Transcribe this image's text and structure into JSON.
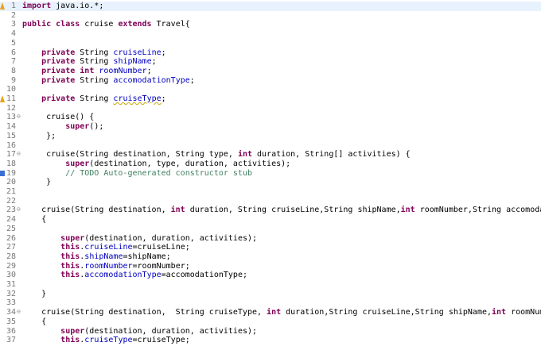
{
  "colors": {
    "keyword": "#7f0055",
    "field": "#0000c0",
    "comment": "#3f7f5f",
    "line_number": "#787878",
    "current_line": "#e8f2fe",
    "warning_marker": "#e8a317",
    "task_marker": "#3b6fd4"
  },
  "lines": [
    {
      "n": "1",
      "marker": "warning-icon",
      "tokens": [
        {
          "t": "import",
          "c": "kw"
        },
        {
          "t": " java.io.*;"
        }
      ]
    },
    {
      "n": "2",
      "tokens": []
    },
    {
      "n": "3",
      "tokens": [
        {
          "t": "public",
          "c": "kw"
        },
        {
          "t": " "
        },
        {
          "t": "class",
          "c": "kw"
        },
        {
          "t": " cruise "
        },
        {
          "t": "extends",
          "c": "kw"
        },
        {
          "t": " Travel{"
        }
      ]
    },
    {
      "n": "4",
      "tokens": []
    },
    {
      "n": "5",
      "tokens": []
    },
    {
      "n": "6",
      "tokens": [
        {
          "t": "    "
        },
        {
          "t": "private",
          "c": "kw"
        },
        {
          "t": " String "
        },
        {
          "t": "cruiseLine",
          "c": "fld"
        },
        {
          "t": ";"
        }
      ]
    },
    {
      "n": "7",
      "tokens": [
        {
          "t": "    "
        },
        {
          "t": "private",
          "c": "kw"
        },
        {
          "t": " String "
        },
        {
          "t": "shipName",
          "c": "fld"
        },
        {
          "t": ";"
        }
      ]
    },
    {
      "n": "8",
      "tokens": [
        {
          "t": "    "
        },
        {
          "t": "private",
          "c": "kw"
        },
        {
          "t": " "
        },
        {
          "t": "int",
          "c": "kw"
        },
        {
          "t": " "
        },
        {
          "t": "roomNumber",
          "c": "fld"
        },
        {
          "t": ";"
        }
      ]
    },
    {
      "n": "9",
      "tokens": [
        {
          "t": "    "
        },
        {
          "t": "private",
          "c": "kw"
        },
        {
          "t": " String "
        },
        {
          "t": "accomodationType",
          "c": "fld"
        },
        {
          "t": ";"
        }
      ]
    },
    {
      "n": "10",
      "tokens": []
    },
    {
      "n": "11",
      "marker": "warning-icon",
      "tokens": [
        {
          "t": "    "
        },
        {
          "t": "private",
          "c": "kw"
        },
        {
          "t": " String "
        },
        {
          "t": "cruiseType",
          "c": "fld ul"
        },
        {
          "t": ";"
        }
      ]
    },
    {
      "n": "12",
      "tokens": []
    },
    {
      "n": "13",
      "fold": "⊖",
      "tokens": [
        {
          "t": "     cruise() {"
        }
      ]
    },
    {
      "n": "14",
      "tokens": [
        {
          "t": "         "
        },
        {
          "t": "super",
          "c": "kw"
        },
        {
          "t": "();"
        }
      ]
    },
    {
      "n": "15",
      "tokens": [
        {
          "t": "     };"
        }
      ]
    },
    {
      "n": "16",
      "tokens": []
    },
    {
      "n": "17",
      "fold": "⊖",
      "tokens": [
        {
          "t": "     cruise(String destination, String type, "
        },
        {
          "t": "int",
          "c": "kw"
        },
        {
          "t": " duration, String[] activities) {"
        }
      ]
    },
    {
      "n": "18",
      "tokens": [
        {
          "t": "         "
        },
        {
          "t": "super",
          "c": "kw"
        },
        {
          "t": "(destination, type, duration, activities);"
        }
      ]
    },
    {
      "n": "19",
      "marker": "task-icon",
      "tokens": [
        {
          "t": "         "
        },
        {
          "t": "// TODO Auto-generated constructor stub",
          "c": "cm"
        }
      ]
    },
    {
      "n": "20",
      "tokens": [
        {
          "t": "     }"
        }
      ]
    },
    {
      "n": "21",
      "tokens": []
    },
    {
      "n": "22",
      "tokens": []
    },
    {
      "n": "23",
      "fold": "⊖",
      "tokens": [
        {
          "t": "    cruise(String destination, "
        },
        {
          "t": "int",
          "c": "kw"
        },
        {
          "t": " duration, String cruiseLine,String shipName,"
        },
        {
          "t": "int",
          "c": "kw"
        },
        {
          "t": " roomNumber,String accomodationType,String"
        }
      ]
    },
    {
      "n": "24",
      "tokens": [
        {
          "t": "    {"
        }
      ]
    },
    {
      "n": "25",
      "tokens": []
    },
    {
      "n": "26",
      "tokens": [
        {
          "t": "        "
        },
        {
          "t": "super",
          "c": "kw"
        },
        {
          "t": "(destination, duration, activities);"
        }
      ]
    },
    {
      "n": "27",
      "tokens": [
        {
          "t": "        "
        },
        {
          "t": "this",
          "c": "kw"
        },
        {
          "t": "."
        },
        {
          "t": "cruiseLine",
          "c": "fld"
        },
        {
          "t": "=cruiseLine;"
        }
      ]
    },
    {
      "n": "28",
      "tokens": [
        {
          "t": "        "
        },
        {
          "t": "this",
          "c": "kw"
        },
        {
          "t": "."
        },
        {
          "t": "shipName",
          "c": "fld"
        },
        {
          "t": "=shipName;"
        }
      ]
    },
    {
      "n": "29",
      "tokens": [
        {
          "t": "        "
        },
        {
          "t": "this",
          "c": "kw"
        },
        {
          "t": "."
        },
        {
          "t": "roomNumber",
          "c": "fld"
        },
        {
          "t": "=roomNumber;"
        }
      ]
    },
    {
      "n": "30",
      "tokens": [
        {
          "t": "        "
        },
        {
          "t": "this",
          "c": "kw"
        },
        {
          "t": "."
        },
        {
          "t": "accomodationType",
          "c": "fld"
        },
        {
          "t": "=accomodationType;"
        }
      ]
    },
    {
      "n": "31",
      "tokens": []
    },
    {
      "n": "32",
      "tokens": [
        {
          "t": "    }"
        }
      ]
    },
    {
      "n": "33",
      "tokens": []
    },
    {
      "n": "34",
      "fold": "⊖",
      "tokens": [
        {
          "t": "    cruise(String destination,  String cruiseType, "
        },
        {
          "t": "int",
          "c": "kw"
        },
        {
          "t": " duration,String cruiseLine,String shipName,"
        },
        {
          "t": "int",
          "c": "kw"
        },
        {
          "t": " roomNumber,String acco"
        }
      ]
    },
    {
      "n": "35",
      "tokens": [
        {
          "t": "    {"
        }
      ]
    },
    {
      "n": "36",
      "tokens": [
        {
          "t": "        "
        },
        {
          "t": "super",
          "c": "kw"
        },
        {
          "t": "(destination, duration, activities);"
        }
      ]
    },
    {
      "n": "37",
      "tokens": [
        {
          "t": "        "
        },
        {
          "t": "this",
          "c": "kw"
        },
        {
          "t": "."
        },
        {
          "t": "cruiseType",
          "c": "fld"
        },
        {
          "t": "=cruiseType;"
        }
      ]
    }
  ]
}
